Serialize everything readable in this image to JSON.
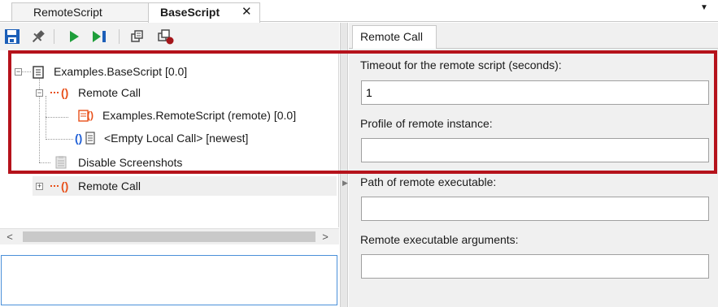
{
  "tabs": [
    {
      "label": "RemoteScript",
      "active": false
    },
    {
      "label": "BaseScript",
      "active": true,
      "close_glyph": "✕"
    }
  ],
  "toolbar": {
    "buttons": [
      "save-icon",
      "pin-icon",
      "run-icon",
      "run-to-end-icon",
      "copy-icon",
      "breakpoint-icon"
    ]
  },
  "tree": {
    "nodes": [
      {
        "label": "Examples.BaseScript [0.0]",
        "icon": "script-icon",
        "expander": "−"
      },
      {
        "label": "Remote Call",
        "icon": "remote-call-icon",
        "expander": "−"
      },
      {
        "label": "Examples.RemoteScript (remote) [0.0]",
        "icon": "remote-script-icon"
      },
      {
        "label": "<Empty Local Call> [newest]",
        "icon": "local-call-icon"
      },
      {
        "label": "Disable Screenshots",
        "icon": "disabled-step-icon"
      },
      {
        "label": "Remote Call",
        "icon": "remote-call-icon",
        "expander": "+"
      }
    ]
  },
  "scrollbar": {
    "left_arrow": "<",
    "right_arrow": ">"
  },
  "properties": {
    "tab_label": "Remote Call",
    "fields": [
      {
        "label": "Timeout for the remote script (seconds):",
        "value": "1"
      },
      {
        "label": "Profile of remote instance:",
        "value": ""
      },
      {
        "label": "Path of remote executable:",
        "value": ""
      },
      {
        "label": "Remote executable arguments:",
        "value": ""
      }
    ]
  },
  "colors": {
    "highlight": "#b5121b",
    "remote_call": "#e8501a",
    "local_call": "#1f5fd6",
    "run_green": "#1e9e3a",
    "save_blue": "#1c5fb8"
  }
}
